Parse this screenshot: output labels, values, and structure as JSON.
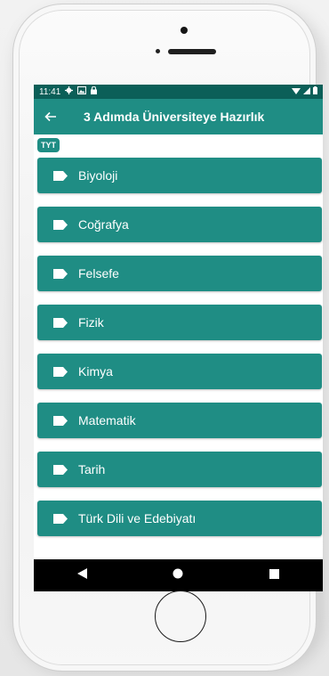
{
  "status_bar": {
    "time": "11:41",
    "left_icons": [
      "gear-icon",
      "image-icon",
      "lock-icon"
    ],
    "right_icons": [
      "wifi-icon",
      "signal-icon",
      "battery-icon"
    ]
  },
  "app_bar": {
    "title": "3 Adımda Üniversiteye Hazırlık",
    "back_icon": "arrow-left-icon"
  },
  "chip": {
    "label": "TYT"
  },
  "subjects": [
    {
      "label": "Biyoloji",
      "icon": "tag-icon"
    },
    {
      "label": "Coğrafya",
      "icon": "tag-icon"
    },
    {
      "label": "Felsefe",
      "icon": "tag-icon"
    },
    {
      "label": "Fizik",
      "icon": "tag-icon"
    },
    {
      "label": "Kimya",
      "icon": "tag-icon"
    },
    {
      "label": "Matematik",
      "icon": "tag-icon"
    },
    {
      "label": "Tarih",
      "icon": "tag-icon"
    },
    {
      "label": "Türk Dili ve Edebiyatı",
      "icon": "tag-icon"
    }
  ],
  "nav_bar": {
    "buttons": [
      "back-triangle-icon",
      "home-circle-icon",
      "recents-square-icon"
    ]
  },
  "colors": {
    "primary": "#1f8d84",
    "status_bar": "#0b5f58",
    "nav_bar": "#000000",
    "text_on_primary": "#ffffff"
  }
}
